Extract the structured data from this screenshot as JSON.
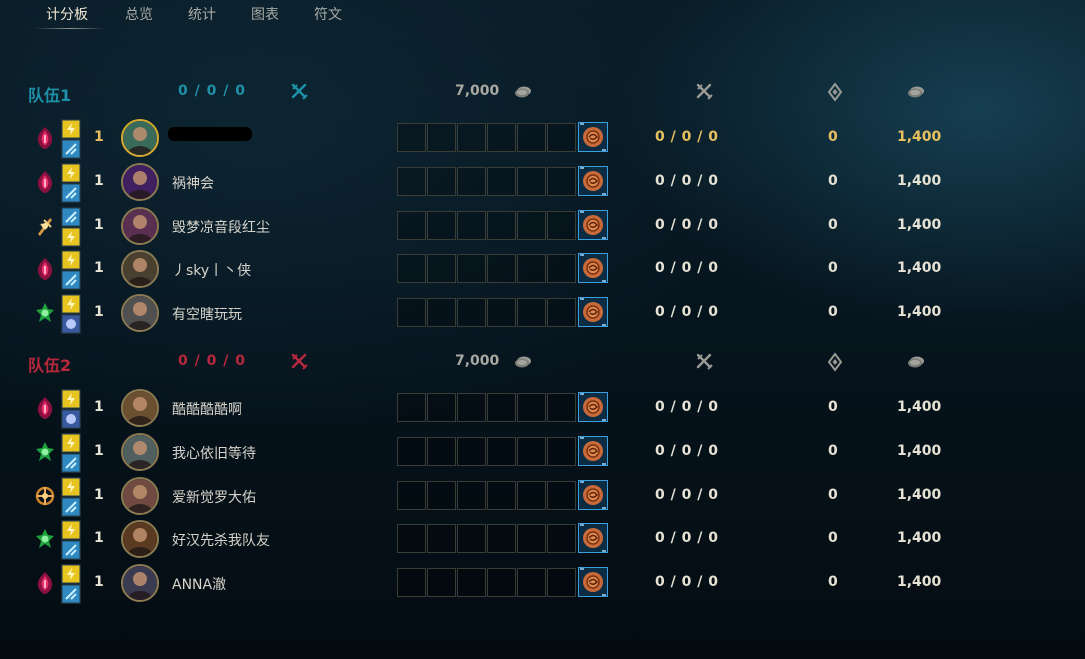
{
  "tabs": [
    {
      "label": "计分板",
      "active": true
    },
    {
      "label": "总览",
      "active": false
    },
    {
      "label": "统计",
      "active": false
    },
    {
      "label": "图表",
      "active": false
    },
    {
      "label": "符文",
      "active": false
    }
  ],
  "colors": {
    "team1": "#1e90a8",
    "team2": "#b8283c",
    "highlight": "#e8c060",
    "text": "#e6e2d4"
  },
  "teams": [
    {
      "name": "队伍1",
      "kda": "0 / 0 / 0",
      "gold": "7,000",
      "players": [
        {
          "level": "1",
          "name": "",
          "redacted": true,
          "kda": "0 / 0 / 0",
          "cs": "0",
          "gold": "1,400",
          "is_me": true,
          "rune_icon": "electrocute-icon"
        },
        {
          "level": "1",
          "name": "祸神会",
          "redacted": false,
          "kda": "0 / 0 / 0",
          "cs": "0",
          "gold": "1,400",
          "is_me": false,
          "rune_icon": "electrocute-icon"
        },
        {
          "level": "1",
          "name": "毁梦凉音段红尘",
          "redacted": false,
          "kda": "0 / 0 / 0",
          "cs": "0",
          "gold": "1,400",
          "is_me": false,
          "rune_icon": "conqueror-icon"
        },
        {
          "level": "1",
          "name": "丿sky丨丶侠",
          "redacted": false,
          "kda": "0 / 0 / 0",
          "cs": "0",
          "gold": "1,400",
          "is_me": false,
          "rune_icon": "electrocute-icon"
        },
        {
          "level": "1",
          "name": "有空瞎玩玩",
          "redacted": false,
          "kda": "0 / 0 / 0",
          "cs": "0",
          "gold": "1,400",
          "is_me": false,
          "rune_icon": "grasp-icon"
        }
      ]
    },
    {
      "name": "队伍2",
      "kda": "0 / 0 / 0",
      "gold": "7,000",
      "players": [
        {
          "level": "1",
          "name": "酷酷酷酷啊",
          "redacted": false,
          "kda": "0 / 0 / 0",
          "cs": "0",
          "gold": "1,400",
          "is_me": false,
          "rune_icon": "electrocute-icon"
        },
        {
          "level": "1",
          "name": "我心依旧等待",
          "redacted": false,
          "kda": "0 / 0 / 0",
          "cs": "0",
          "gold": "1,400",
          "is_me": false,
          "rune_icon": "grasp-icon"
        },
        {
          "level": "1",
          "name": "爱新觉罗大佑",
          "redacted": false,
          "kda": "0 / 0 / 0",
          "cs": "0",
          "gold": "1,400",
          "is_me": false,
          "rune_icon": "lethal-tempo-icon"
        },
        {
          "level": "1",
          "name": "好汉先杀我队友",
          "redacted": false,
          "kda": "0 / 0 / 0",
          "cs": "0",
          "gold": "1,400",
          "is_me": false,
          "rune_icon": "grasp-icon"
        },
        {
          "level": "1",
          "name": "ANNA澈",
          "redacted": false,
          "kda": "0 / 0 / 0",
          "cs": "0",
          "gold": "1,400",
          "is_me": false,
          "rune_icon": "electrocute-icon"
        }
      ]
    }
  ]
}
